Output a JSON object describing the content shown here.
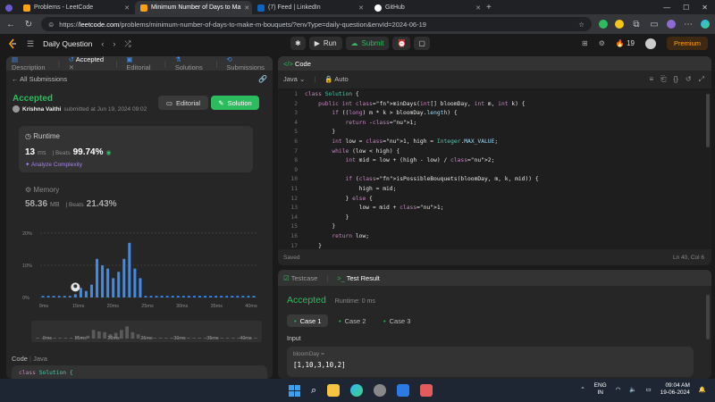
{
  "browser": {
    "tabs": [
      {
        "title": "Problems - LeetCode",
        "color": "#ffa116",
        "active": false
      },
      {
        "title": "Minimum Number of Days to Ma",
        "color": "#ffa116",
        "active": true
      },
      {
        "title": "(7) Feed | LinkedIn",
        "color": "#0a66c2",
        "active": false
      },
      {
        "title": "GitHub",
        "color": "#ffffff",
        "active": false
      }
    ],
    "url_host": "leetcode.com",
    "url_path": "/problems/minimum-number-of-days-to-make-m-bouquets/?envType=daily-question&envId=2024-06-19",
    "url_scheme": "https://"
  },
  "header": {
    "title": "Daily Question",
    "run_label": "Run",
    "submit_label": "Submit",
    "streak": "19",
    "premium_label": "Premium"
  },
  "left": {
    "tabs": [
      "Description",
      "Accepted",
      "Editorial",
      "Solutions",
      "Submissions"
    ],
    "back_label": "All Submissions",
    "status": "Accepted",
    "user": "Krishna Vaithi",
    "submitted": "submitted at Jun 19, 2024 09:02",
    "editorial_btn": "Editorial",
    "solution_btn": "Solution",
    "runtime_label": "Runtime",
    "runtime_value": "13",
    "runtime_unit": "ms",
    "beats_label": "Beats",
    "runtime_beats": "99.74%",
    "analyze_label": "Analyze Complexity",
    "memory_label": "Memory",
    "memory_value": "58.36",
    "memory_unit": "MB",
    "memory_beats": "21.43%",
    "code_label": "Code",
    "code_lang": "Java",
    "code_preview_kw": "class",
    "code_preview_name": "Solution {"
  },
  "chart_data": {
    "type": "bar",
    "ylabels": [
      "20%",
      "10%",
      "0%"
    ],
    "xlabels": [
      "9ms",
      "15ms",
      "20ms",
      "25ms",
      "30ms",
      "35ms",
      "40ms"
    ],
    "values": [
      0.5,
      0.5,
      0.5,
      0.5,
      0.5,
      0.5,
      1,
      3,
      2,
      4,
      12,
      10,
      9,
      6,
      8,
      12,
      17,
      9,
      6,
      0.5,
      0.5,
      0.5,
      0.5,
      0.5,
      0.5,
      0.5,
      0.5,
      0.5,
      0.5,
      0.5,
      0.5,
      0.5,
      0.5,
      0.5,
      0.5,
      0.5,
      0.5,
      0.5,
      0.5,
      0.5
    ],
    "ylim": [
      0,
      20
    ],
    "highlight_index": 6,
    "bar_color": "#3c8cf0",
    "mini_labels": [
      "9ms",
      "15ms",
      "20ms",
      "25ms",
      "30ms",
      "35ms",
      "40ms"
    ]
  },
  "editor": {
    "title": "Code",
    "lang": "Java",
    "mode": "Auto",
    "status": "Saved",
    "cursor": "Ln 40, Col 6",
    "lines": [
      "class Solution {",
      "    public int minDays(int[] bloomDay, int m, int k) {",
      "        if ((long) m * k > bloomDay.length) {",
      "            return -1;",
      "        }",
      "        int low = 1, high = Integer.MAX_VALUE;",
      "        while (low < high) {",
      "            int mid = low + (high - low) / 2;",
      "",
      "            if (isPossibleBouquets(bloomDay, m, k, mid)) {",
      "                high = mid;",
      "            } else {",
      "                low = mid + 1;",
      "            }",
      "        }",
      "        return low;",
      "    }",
      "",
      "    private boolean isPossibleBouquets(int[] bloomDay, int m, int k, int day) {"
    ]
  },
  "result": {
    "tab_testcase": "Testcase",
    "tab_result": "Test Result",
    "status": "Accepted",
    "runtime": "Runtime: 0 ms",
    "cases": [
      "Case 1",
      "Case 2",
      "Case 3"
    ],
    "input_label": "Input",
    "var_label": "bloomDay =",
    "var_value": "[1,10,3,10,2]"
  },
  "taskbar": {
    "lang": "ENG",
    "region": "IN",
    "time": "09:04 AM",
    "date": "19-06-2024"
  }
}
